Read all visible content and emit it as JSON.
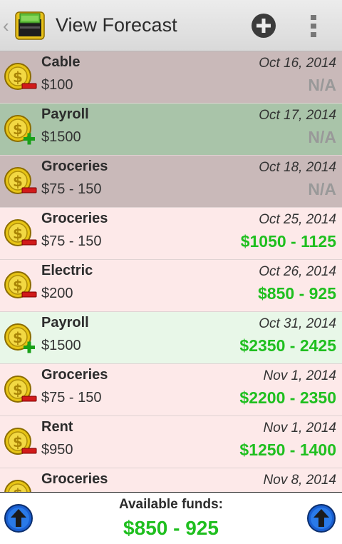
{
  "header": {
    "title": "View Forecast"
  },
  "colors": {
    "expense_past": "#c9b9b9",
    "income_past": "#a9c4a9",
    "expense_future": "#fde9e9",
    "income_future": "#e8f7e8",
    "balance_green": "#1fbf1f",
    "na_gray": "#999999"
  },
  "rows": [
    {
      "name": "Cable",
      "amount": "$100",
      "date": "Oct 16, 2014",
      "balance": "N/A",
      "type": "expense",
      "state": "past"
    },
    {
      "name": "Payroll",
      "amount": "$1500",
      "date": "Oct 17, 2014",
      "balance": "N/A",
      "type": "income",
      "state": "past"
    },
    {
      "name": "Groceries",
      "amount": "$75 - 150",
      "date": "Oct 18, 2014",
      "balance": "N/A",
      "type": "expense",
      "state": "past"
    },
    {
      "name": "Groceries",
      "amount": "$75 - 150",
      "date": "Oct 25, 2014",
      "balance": "$1050 - 1125",
      "type": "expense",
      "state": "future"
    },
    {
      "name": "Electric",
      "amount": "$200",
      "date": "Oct 26, 2014",
      "balance": "$850 - 925",
      "type": "expense",
      "state": "future"
    },
    {
      "name": "Payroll",
      "amount": "$1500",
      "date": "Oct 31, 2014",
      "balance": "$2350 - 2425",
      "type": "income",
      "state": "future"
    },
    {
      "name": "Groceries",
      "amount": "$75 - 150",
      "date": "Nov 1, 2014",
      "balance": "$2200 - 2350",
      "type": "expense",
      "state": "future"
    },
    {
      "name": "Rent",
      "amount": "$950",
      "date": "Nov 1, 2014",
      "balance": "$1250 - 1400",
      "type": "expense",
      "state": "future"
    },
    {
      "name": "Groceries",
      "amount": "",
      "date": "Nov 8, 2014",
      "balance": "",
      "type": "expense",
      "state": "future"
    }
  ],
  "footer": {
    "label": "Available funds:",
    "funds": "$850 - 925"
  },
  "icons": {
    "app": "app-wallet-icon",
    "add": "add-circle-icon",
    "overflow": "overflow-menu-icon",
    "coin": "dollar-coin-icon",
    "scroll_up": "up-arrow-icon"
  }
}
